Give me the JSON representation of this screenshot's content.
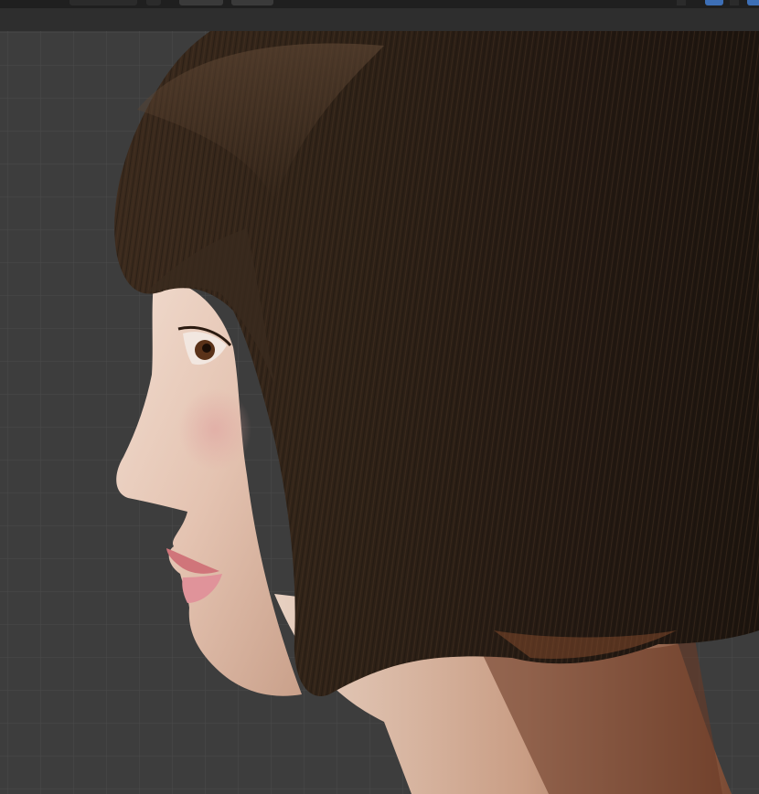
{
  "window": {
    "header": {
      "editor_mode": "",
      "viewport_shading": "",
      "overlay": "",
      "gizmo": ""
    }
  },
  "viewport": {
    "background_color": "#3d3d3d",
    "grid_color": "#4a4a4a",
    "grid_visible": true,
    "content": "3d-render-preview",
    "hair_color": "#2e2118",
    "skin_color": "#e8c9b7"
  },
  "colors": {
    "header_bg": "#1f1f1f",
    "tool_header_bg": "#2e2e2e",
    "accent": "#3d6fb6"
  }
}
